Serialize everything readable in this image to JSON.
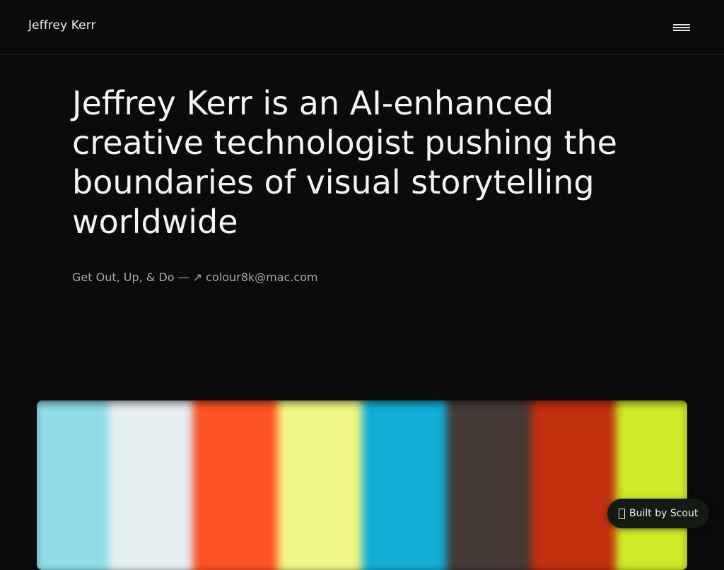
{
  "header": {
    "brand": "Jeffrey Kerr",
    "menu_icon": "hamburger-menu-icon"
  },
  "hero": {
    "title": "Jeffrey Kerr is an AI-enhanced creative technologist pushing the boundaries of visual storytelling worldwide",
    "tagline_prefix": "Get Out, Up, & Do — ",
    "email_arrow": "↗",
    "email": "colour8k@mac.com"
  },
  "palette": {
    "colors": [
      "#8fdde8",
      "#e7eff3",
      "#fe5222",
      "#f1f784",
      "#12aed6",
      "#443935",
      "#c22f0e",
      "#cfe928"
    ]
  },
  "badge": {
    "icon": "scout-icon",
    "label": "Built by Scout"
  }
}
